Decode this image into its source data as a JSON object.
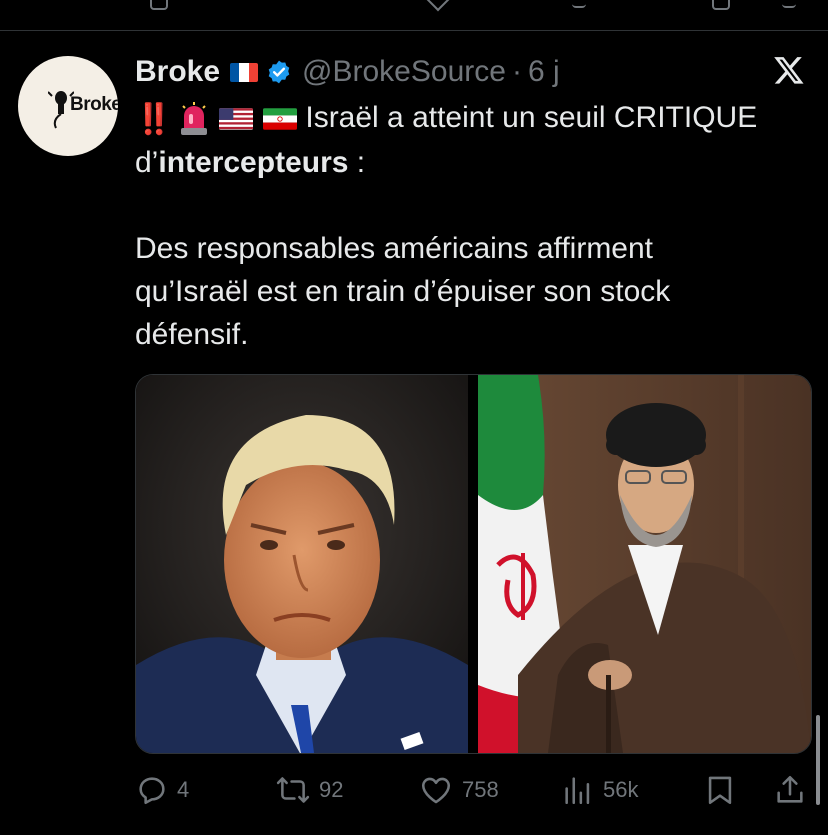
{
  "tweet": {
    "author": {
      "name": "Broke",
      "handle": "@BrokeSource",
      "time": "6 j",
      "separator": "·",
      "avatar_text": "Broke",
      "verified": true
    },
    "emojis": [
      "double-exclamation-mark",
      "police-light",
      "flag-us",
      "flag-iran"
    ],
    "emoji_text": "‼️",
    "text": {
      "line1": "Israël a atteint un seuil CRITIQUE",
      "line2_prefix": "d’",
      "line2_bold": "intercepteurs",
      "line2_suffix": " :",
      "para2_line1": "Des responsables américains affirment",
      "para2_line2": "qu’Israël est en train d’épuiser son stock",
      "para2_line3": "défensif."
    },
    "media": [
      {
        "id": "photo-left",
        "description_icon": "portrait-photo"
      },
      {
        "id": "photo-right",
        "description_icon": "portrait-photo"
      }
    ],
    "stats": {
      "replies": "4",
      "reposts": "92",
      "likes": "758",
      "views": "56k"
    }
  },
  "colors": {
    "background": "#000000",
    "text": "#e7e9ea",
    "muted": "#71767b",
    "verified": "#1d9bf0",
    "divider": "#2f3336"
  },
  "icons": [
    "reply-icon",
    "repost-icon",
    "like-icon",
    "views-icon",
    "bookmark-icon",
    "share-icon",
    "x-logo-icon",
    "verified-badge-icon"
  ]
}
